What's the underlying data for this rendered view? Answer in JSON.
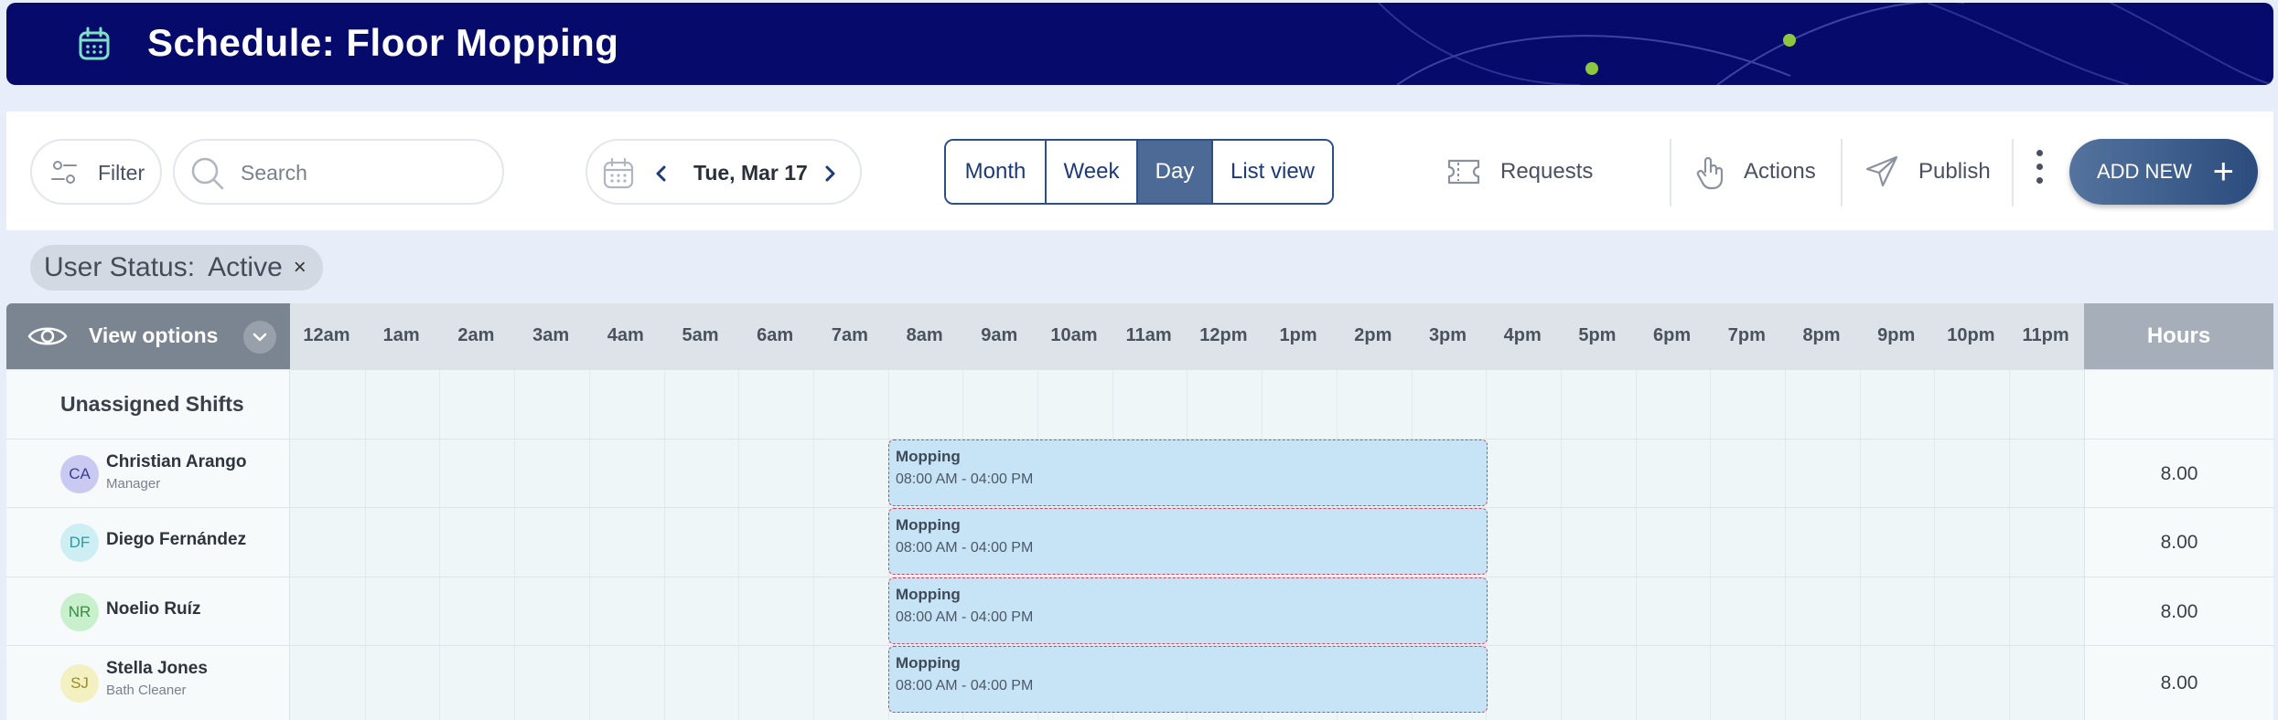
{
  "header": {
    "title": "Schedule: Floor Mopping",
    "bg_color": "#060a6b",
    "accent_dot_color": "#8dc63f"
  },
  "toolbar": {
    "filter_label": "Filter",
    "search_placeholder": "Search",
    "date_label": "Tue, Mar 17",
    "views": [
      {
        "label": "Month",
        "active": false
      },
      {
        "label": "Week",
        "active": false
      },
      {
        "label": "Day",
        "active": true
      },
      {
        "label": "List view",
        "active": false
      }
    ],
    "requests_label": "Requests",
    "actions_label": "Actions",
    "publish_label": "Publish",
    "add_new_label": "ADD NEW",
    "add_new_icon": "plus-icon"
  },
  "chip": {
    "label": "User Status:",
    "value": "Active",
    "close": "×"
  },
  "grid": {
    "view_options_label": "View options",
    "time_slots": [
      "12am",
      "1am",
      "2am",
      "3am",
      "4am",
      "5am",
      "6am",
      "7am",
      "8am",
      "9am",
      "10am",
      "11am",
      "12pm",
      "1pm",
      "2pm",
      "3pm",
      "4pm",
      "5pm",
      "6pm",
      "7pm",
      "8pm",
      "9pm",
      "10pm",
      "11pm"
    ],
    "hours_header": "Hours",
    "unassigned_label": "Unassigned Shifts",
    "employees": [
      {
        "initials": "CA",
        "name": "Christian Arango",
        "role": "Manager",
        "avatar_bg": "#c9c9f2",
        "avatar_fg": "#3d3d99",
        "shift_title": "Mopping",
        "shift_time": "08:00 AM - 04:00 PM",
        "hours": "8.00"
      },
      {
        "initials": "DF",
        "name": "Diego Fernández",
        "role": "",
        "avatar_bg": "#cdeff3",
        "avatar_fg": "#2e9aa6",
        "shift_title": "Mopping",
        "shift_time": "08:00 AM - 04:00 PM",
        "hours": "8.00"
      },
      {
        "initials": "NR",
        "name": "Noelio Ruíz",
        "role": "",
        "avatar_bg": "#c9f0cd",
        "avatar_fg": "#3b8a44",
        "shift_title": "Mopping",
        "shift_time": "08:00 AM - 04:00 PM",
        "hours": "8.00"
      },
      {
        "initials": "SJ",
        "name": "Stella Jones",
        "role": "Bath Cleaner",
        "avatar_bg": "#f3f0c2",
        "avatar_fg": "#9a8c2a",
        "shift_title": "Mopping",
        "shift_time": "08:00 AM - 04:00 PM",
        "hours": "8.00"
      }
    ]
  }
}
